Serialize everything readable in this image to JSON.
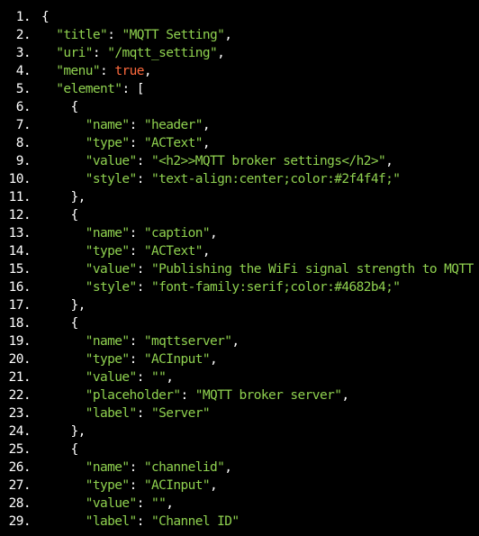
{
  "colors": {
    "background": "#000000",
    "line_number": "#ffffff",
    "punctuation": "#ffffff",
    "key": "#8fd14f",
    "string": "#8fd14f",
    "boolean": "#ff6a3d"
  },
  "lines": [
    {
      "num": "1.",
      "tokens": [
        [
          "punct",
          "{"
        ]
      ]
    },
    {
      "num": "2.",
      "tokens": [
        [
          "ws",
          "  "
        ],
        [
          "key",
          "\"title\""
        ],
        [
          "punct",
          ": "
        ],
        [
          "string",
          "\"MQTT Setting\""
        ],
        [
          "punct",
          ","
        ]
      ]
    },
    {
      "num": "3.",
      "tokens": [
        [
          "ws",
          "  "
        ],
        [
          "key",
          "\"uri\""
        ],
        [
          "punct",
          ": "
        ],
        [
          "string",
          "\"/mqtt_setting\""
        ],
        [
          "punct",
          ","
        ]
      ]
    },
    {
      "num": "4.",
      "tokens": [
        [
          "ws",
          "  "
        ],
        [
          "key",
          "\"menu\""
        ],
        [
          "punct",
          ": "
        ],
        [
          "bool",
          "true"
        ],
        [
          "punct",
          ","
        ]
      ]
    },
    {
      "num": "5.",
      "tokens": [
        [
          "ws",
          "  "
        ],
        [
          "key",
          "\"element\""
        ],
        [
          "punct",
          ": ["
        ]
      ]
    },
    {
      "num": "6.",
      "tokens": [
        [
          "ws",
          "    "
        ],
        [
          "punct",
          "{"
        ]
      ]
    },
    {
      "num": "7.",
      "tokens": [
        [
          "ws",
          "      "
        ],
        [
          "key",
          "\"name\""
        ],
        [
          "punct",
          ": "
        ],
        [
          "string",
          "\"header\""
        ],
        [
          "punct",
          ","
        ]
      ]
    },
    {
      "num": "8.",
      "tokens": [
        [
          "ws",
          "      "
        ],
        [
          "key",
          "\"type\""
        ],
        [
          "punct",
          ": "
        ],
        [
          "string",
          "\"ACText\""
        ],
        [
          "punct",
          ","
        ]
      ]
    },
    {
      "num": "9.",
      "tokens": [
        [
          "ws",
          "      "
        ],
        [
          "key",
          "\"value\""
        ],
        [
          "punct",
          ": "
        ],
        [
          "string",
          "\"<h2>>MQTT broker settings</h2>\""
        ],
        [
          "punct",
          ","
        ]
      ]
    },
    {
      "num": "10.",
      "tokens": [
        [
          "ws",
          "      "
        ],
        [
          "key",
          "\"style\""
        ],
        [
          "punct",
          ": "
        ],
        [
          "string",
          "\"text-align:center;color:#2f4f4f;\""
        ]
      ]
    },
    {
      "num": "11.",
      "tokens": [
        [
          "ws",
          "    "
        ],
        [
          "punct",
          "},"
        ]
      ]
    },
    {
      "num": "12.",
      "tokens": [
        [
          "ws",
          "    "
        ],
        [
          "punct",
          "{"
        ]
      ]
    },
    {
      "num": "13.",
      "tokens": [
        [
          "ws",
          "      "
        ],
        [
          "key",
          "\"name\""
        ],
        [
          "punct",
          ": "
        ],
        [
          "string",
          "\"caption\""
        ],
        [
          "punct",
          ","
        ]
      ]
    },
    {
      "num": "14.",
      "tokens": [
        [
          "ws",
          "      "
        ],
        [
          "key",
          "\"type\""
        ],
        [
          "punct",
          ": "
        ],
        [
          "string",
          "\"ACText\""
        ],
        [
          "punct",
          ","
        ]
      ]
    },
    {
      "num": "15.",
      "tokens": [
        [
          "ws",
          "      "
        ],
        [
          "key",
          "\"value\""
        ],
        [
          "punct",
          ": "
        ],
        [
          "string",
          "\"Publishing the WiFi signal strength to MQTT"
        ]
      ]
    },
    {
      "num": "16.",
      "tokens": [
        [
          "ws",
          "      "
        ],
        [
          "key",
          "\"style\""
        ],
        [
          "punct",
          ": "
        ],
        [
          "string",
          "\"font-family:serif;color:#4682b4;\""
        ]
      ]
    },
    {
      "num": "17.",
      "tokens": [
        [
          "ws",
          "    "
        ],
        [
          "punct",
          "},"
        ]
      ]
    },
    {
      "num": "18.",
      "tokens": [
        [
          "ws",
          "    "
        ],
        [
          "punct",
          "{"
        ]
      ]
    },
    {
      "num": "19.",
      "tokens": [
        [
          "ws",
          "      "
        ],
        [
          "key",
          "\"name\""
        ],
        [
          "punct",
          ": "
        ],
        [
          "string",
          "\"mqttserver\""
        ],
        [
          "punct",
          ","
        ]
      ]
    },
    {
      "num": "20.",
      "tokens": [
        [
          "ws",
          "      "
        ],
        [
          "key",
          "\"type\""
        ],
        [
          "punct",
          ": "
        ],
        [
          "string",
          "\"ACInput\""
        ],
        [
          "punct",
          ","
        ]
      ]
    },
    {
      "num": "21.",
      "tokens": [
        [
          "ws",
          "      "
        ],
        [
          "key",
          "\"value\""
        ],
        [
          "punct",
          ": "
        ],
        [
          "string",
          "\"\""
        ],
        [
          "punct",
          ","
        ]
      ]
    },
    {
      "num": "22.",
      "tokens": [
        [
          "ws",
          "      "
        ],
        [
          "key",
          "\"placeholder\""
        ],
        [
          "punct",
          ": "
        ],
        [
          "string",
          "\"MQTT broker server\""
        ],
        [
          "punct",
          ","
        ]
      ]
    },
    {
      "num": "23.",
      "tokens": [
        [
          "ws",
          "      "
        ],
        [
          "key",
          "\"label\""
        ],
        [
          "punct",
          ": "
        ],
        [
          "string",
          "\"Server\""
        ]
      ]
    },
    {
      "num": "24.",
      "tokens": [
        [
          "ws",
          "    "
        ],
        [
          "punct",
          "},"
        ]
      ]
    },
    {
      "num": "25.",
      "tokens": [
        [
          "ws",
          "    "
        ],
        [
          "punct",
          "{"
        ]
      ]
    },
    {
      "num": "26.",
      "tokens": [
        [
          "ws",
          "      "
        ],
        [
          "key",
          "\"name\""
        ],
        [
          "punct",
          ": "
        ],
        [
          "string",
          "\"channelid\""
        ],
        [
          "punct",
          ","
        ]
      ]
    },
    {
      "num": "27.",
      "tokens": [
        [
          "ws",
          "      "
        ],
        [
          "key",
          "\"type\""
        ],
        [
          "punct",
          ": "
        ],
        [
          "string",
          "\"ACInput\""
        ],
        [
          "punct",
          ","
        ]
      ]
    },
    {
      "num": "28.",
      "tokens": [
        [
          "ws",
          "      "
        ],
        [
          "key",
          "\"value\""
        ],
        [
          "punct",
          ": "
        ],
        [
          "string",
          "\"\""
        ],
        [
          "punct",
          ","
        ]
      ]
    },
    {
      "num": "29.",
      "tokens": [
        [
          "ws",
          "      "
        ],
        [
          "key",
          "\"label\""
        ],
        [
          "punct",
          ": "
        ],
        [
          "string",
          "\"Channel ID\""
        ]
      ]
    }
  ]
}
